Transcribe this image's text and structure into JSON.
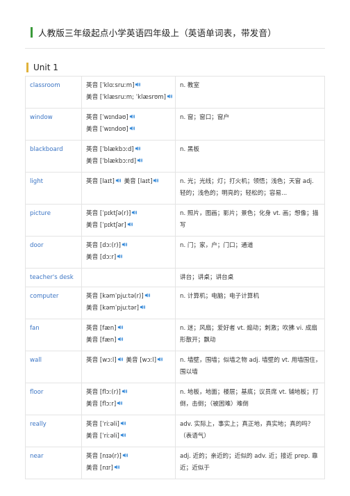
{
  "page": {
    "title": "人教版三年级起点小学英语四年级上（英语单词表，带发音）",
    "unit_title": "Unit 1"
  },
  "colors": {
    "accent_green": "#3a9a3a",
    "accent_gold": "#e0b23a",
    "word_blue": "#3a74c4",
    "speaker_blue": "#2f86d8"
  },
  "speaker_icon": "speaker-icon",
  "rows": [
    {
      "word": "classroom",
      "pron_lines": [
        [
          "英音 [ˈklɑːsruːm]"
        ],
        [
          "美音 [ˈklæsruːm; ˈklæsrʊm]"
        ]
      ],
      "meaning": "n. 教室"
    },
    {
      "word": "window",
      "pron_lines": [
        [
          "英音 [ˈwɪndəʊ]"
        ],
        [
          "美音 [ˈwɪndoʊ]"
        ]
      ],
      "meaning": "n. 窗；窗口；窗户"
    },
    {
      "word": "blackboard",
      "pron_lines": [
        [
          "英音 [ˈblækbɔːd]"
        ],
        [
          "美音 [ˈblækbɔːrd]"
        ]
      ],
      "meaning": "n. 黑板"
    },
    {
      "word": "light",
      "pron_lines": [
        [
          "英音 [laɪt]",
          "美音 [laɪt]"
        ]
      ],
      "meaning": "n. 光；光线；灯；打火机；领悟；浅色；天窗 adj. 轻的；浅色的；明亮的；轻松的；容易..."
    },
    {
      "word": "picture",
      "pron_lines": [
        [
          "英音 [ˈpɪktʃə(r)]"
        ],
        [
          "美音 [ˈpɪktʃər]"
        ]
      ],
      "meaning": "n. 照片，图画；影片；景色；化身 vt. 画；想像；描写"
    },
    {
      "word": "door",
      "pron_lines": [
        [
          "英音 [dɔː(r)]"
        ],
        [
          "美音 [dɔːr]"
        ]
      ],
      "meaning": "n. 门；家，户；门口；通道"
    },
    {
      "word": "teacher's desk",
      "pron_lines": [],
      "meaning": "讲台；讲桌；讲台桌"
    },
    {
      "word": "computer",
      "pron_lines": [
        [
          "英音 [kəmˈpjuːtə(r)]"
        ],
        [
          "美音 [kəmˈpjuːtər]"
        ]
      ],
      "meaning": "n. 计算机；电脑；电子计算机"
    },
    {
      "word": "fan",
      "pron_lines": [
        [
          "英音 [fæn]"
        ],
        [
          "美音 [fæn]"
        ]
      ],
      "meaning": "n. 迷；风扇；爱好者 vt. 煽动；刺激；吹拂 vi. 成扇形散开；飘动"
    },
    {
      "word": "wall",
      "pron_lines": [
        [
          "英音 [wɔːl]",
          "美音 [wɔːl]"
        ]
      ],
      "meaning": "n. 墙壁，围墙；似墙之物 adj. 墙壁的 vt. 用墙围住，围以墙"
    },
    {
      "word": "floor",
      "pron_lines": [
        [
          "英音 [flɔː(r)]"
        ],
        [
          "美音 [flɔːr]"
        ]
      ],
      "meaning": "n. 地板，地面；楼层；基底；议员席 vt. 铺地板；打倒，击倒；（被困难）难倒"
    },
    {
      "word": "really",
      "pron_lines": [
        [
          "英音 [ˈriːəli]"
        ],
        [
          "美音 [ˈriːəli]"
        ]
      ],
      "meaning": "adv. 实际上，事实上；真正地，真实地；真的吗？（表语气）"
    },
    {
      "word": "near",
      "pron_lines": [
        [
          "英音 [nɪə(r)]"
        ],
        [
          "美音 [nɪr]"
        ]
      ],
      "meaning": "adj. 近的；亲近的；近似的 adv. 近；接近 prep. 靠近；近似于"
    }
  ]
}
